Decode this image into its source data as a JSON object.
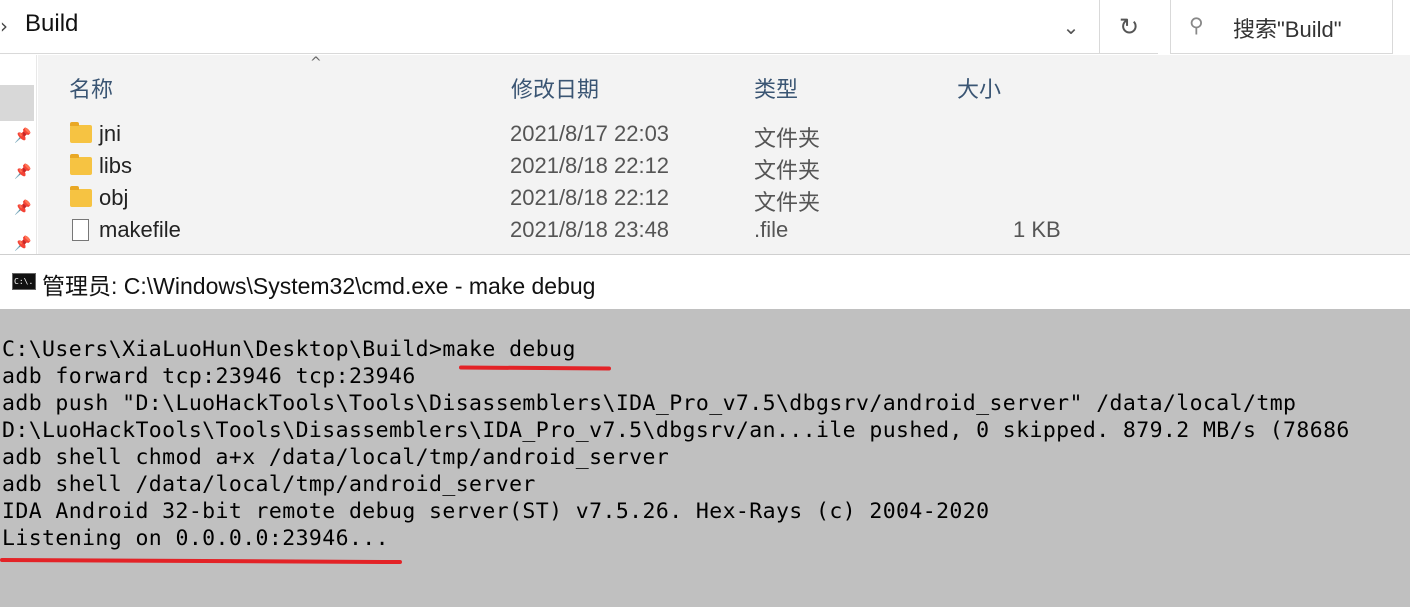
{
  "explorer": {
    "address": {
      "path": "Build"
    },
    "search": {
      "placeholder": "搜索\"Build\""
    },
    "columns": {
      "name": "名称",
      "modified": "修改日期",
      "type": "类型",
      "size": "大小"
    },
    "files": [
      {
        "name": "jni",
        "modified": "2021/8/17 22:03",
        "type": "文件夹",
        "size": "",
        "icon": "folder-icon"
      },
      {
        "name": "libs",
        "modified": "2021/8/18 22:12",
        "type": "文件夹",
        "size": "",
        "icon": "folder-icon"
      },
      {
        "name": "obj",
        "modified": "2021/8/18 22:12",
        "type": "文件夹",
        "size": "",
        "icon": "folder-icon"
      },
      {
        "name": "makefile",
        "modified": "2021/8/18 23:48",
        "type": ".file",
        "size": "1 KB",
        "icon": "document-icon"
      }
    ]
  },
  "cmd": {
    "icon_label": "C:\\.",
    "title": "管理员: C:\\Windows\\System32\\cmd.exe - make  debug",
    "lines": [
      "C:\\Users\\XiaLuoHun\\Desktop\\Build>make debug",
      "adb forward tcp:23946 tcp:23946",
      "adb push \"D:\\LuoHackTools\\Tools\\Disassemblers\\IDA_Pro_v7.5\\dbgsrv/android_server\" /data/local/tmp",
      "D:\\LuoHackTools\\Tools\\Disassemblers\\IDA_Pro_v7.5\\dbgsrv/an...ile pushed, 0 skipped. 879.2 MB/s (78686",
      "adb shell chmod a+x /data/local/tmp/android_server",
      "adb shell /data/local/tmp/android_server",
      "IDA Android 32-bit remote debug server(ST) v7.5.26. Hex-Rays (c) 2004-2020",
      "Listening on 0.0.0.0:23946..."
    ]
  },
  "colors": {
    "console_bg": "#c0c0c0",
    "annotation_red": "#e32327",
    "header_text": "#3a5573",
    "folder": "#f6c342"
  }
}
